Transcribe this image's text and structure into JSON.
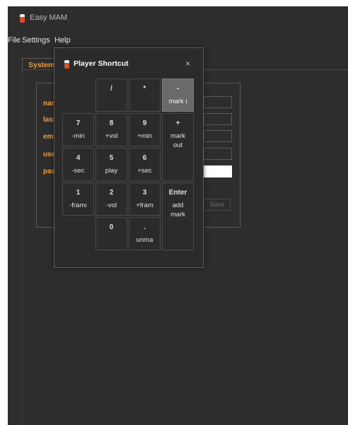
{
  "app": {
    "title": "Easy MAM"
  },
  "menu": {
    "file": "File",
    "settings": "Settings",
    "help": "Help"
  },
  "tab": {
    "label": "System"
  },
  "form": {
    "labels": [
      "name",
      "last",
      "email",
      "user",
      "password"
    ],
    "save_label": "Save"
  },
  "dialog": {
    "title": "Player Shortcut",
    "close": "×",
    "keys": {
      "slash": {
        "main": "/",
        "sub": ""
      },
      "star": {
        "main": "*",
        "sub": ""
      },
      "minus": {
        "main": "-",
        "sub": "mark i"
      },
      "k7": {
        "main": "7",
        "sub": "-min"
      },
      "k8": {
        "main": "8",
        "sub": "+vol"
      },
      "k9": {
        "main": "9",
        "sub": "+min"
      },
      "plus": {
        "main": "+",
        "sub": "mark\nout"
      },
      "k4": {
        "main": "4",
        "sub": "-sec"
      },
      "k5": {
        "main": "5",
        "sub": "play"
      },
      "k6": {
        "main": "6",
        "sub": "+sec"
      },
      "k1": {
        "main": "1",
        "sub": "-framı"
      },
      "k2": {
        "main": "2",
        "sub": "-vol"
      },
      "k3": {
        "main": "3",
        "sub": "+fram"
      },
      "enter": {
        "main": "Enter",
        "sub": "add\nmark"
      },
      "k0": {
        "main": "0",
        "sub": ""
      },
      "dot": {
        "main": ".",
        "sub": "unma"
      }
    }
  }
}
